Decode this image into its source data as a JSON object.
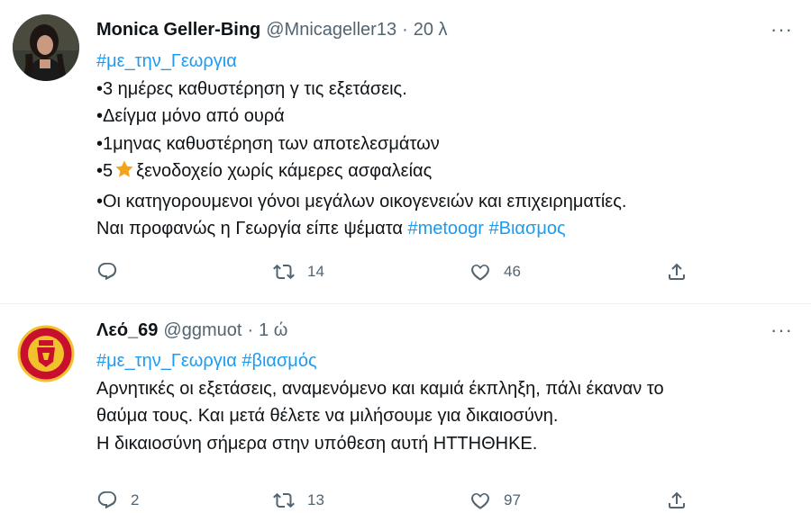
{
  "tweets": [
    {
      "name": "Monica Geller-Bing",
      "handle": "@Mnicageller13",
      "separator": "·",
      "time": "20 λ",
      "more": "···",
      "hashtag_line": "#με_την_Γεωργια",
      "lines": [
        "•3 ημέρες καθυστέρηση γ τις εξετάσεις.",
        "•Δείγμα μόνο από ουρά",
        "•1μηνας καθυστέρηση των αποτελεσμάτων"
      ],
      "star_line_prefix": "•5",
      "star_line_suffix": "ξενοδοχείο χωρίς κάμερες ασφαλείας",
      "line_after_star": "•Οι κατηγορουμενοι γόνοι μεγάλων οικογενειών και επιχειρηματίες.",
      "last_line_text": "Ναι προφανώς η Γεωργία είπε ψέματα ",
      "last_line_tag1": "#metoogr",
      "last_line_tag2": "#Βιασμος",
      "reply_count": "",
      "retweet_count": "14",
      "like_count": "46"
    },
    {
      "name": "Λεό_69",
      "handle": "@ggmuot",
      "separator": "·",
      "time": "1 ώ",
      "more": "···",
      "hashtag1": "#με_την_Γεωργια",
      "hashtag2": "#βιασμός",
      "lines": [
        "Αρνητικές οι εξετάσεις, αναμενόμενο και καμιά έκπληξη, πάλι έκαναν το",
        "θαύμα τους. Και μετά θέλετε να μιλήσουμε για δικαιοσύνη.",
        "Η δικαιοσύνη σήμερα στην υπόθεση αυτή ΗΤΤΗΘΗΚΕ."
      ],
      "reply_count": "2",
      "retweet_count": "13",
      "like_count": "97"
    }
  ],
  "colors": {
    "link": "#1d9bf0",
    "muted": "#536471",
    "text": "#0f1419",
    "star": "#f4a41b"
  },
  "icons": [
    "reply-icon",
    "retweet-icon",
    "like-icon",
    "share-icon",
    "more-icon",
    "star-emoji"
  ]
}
